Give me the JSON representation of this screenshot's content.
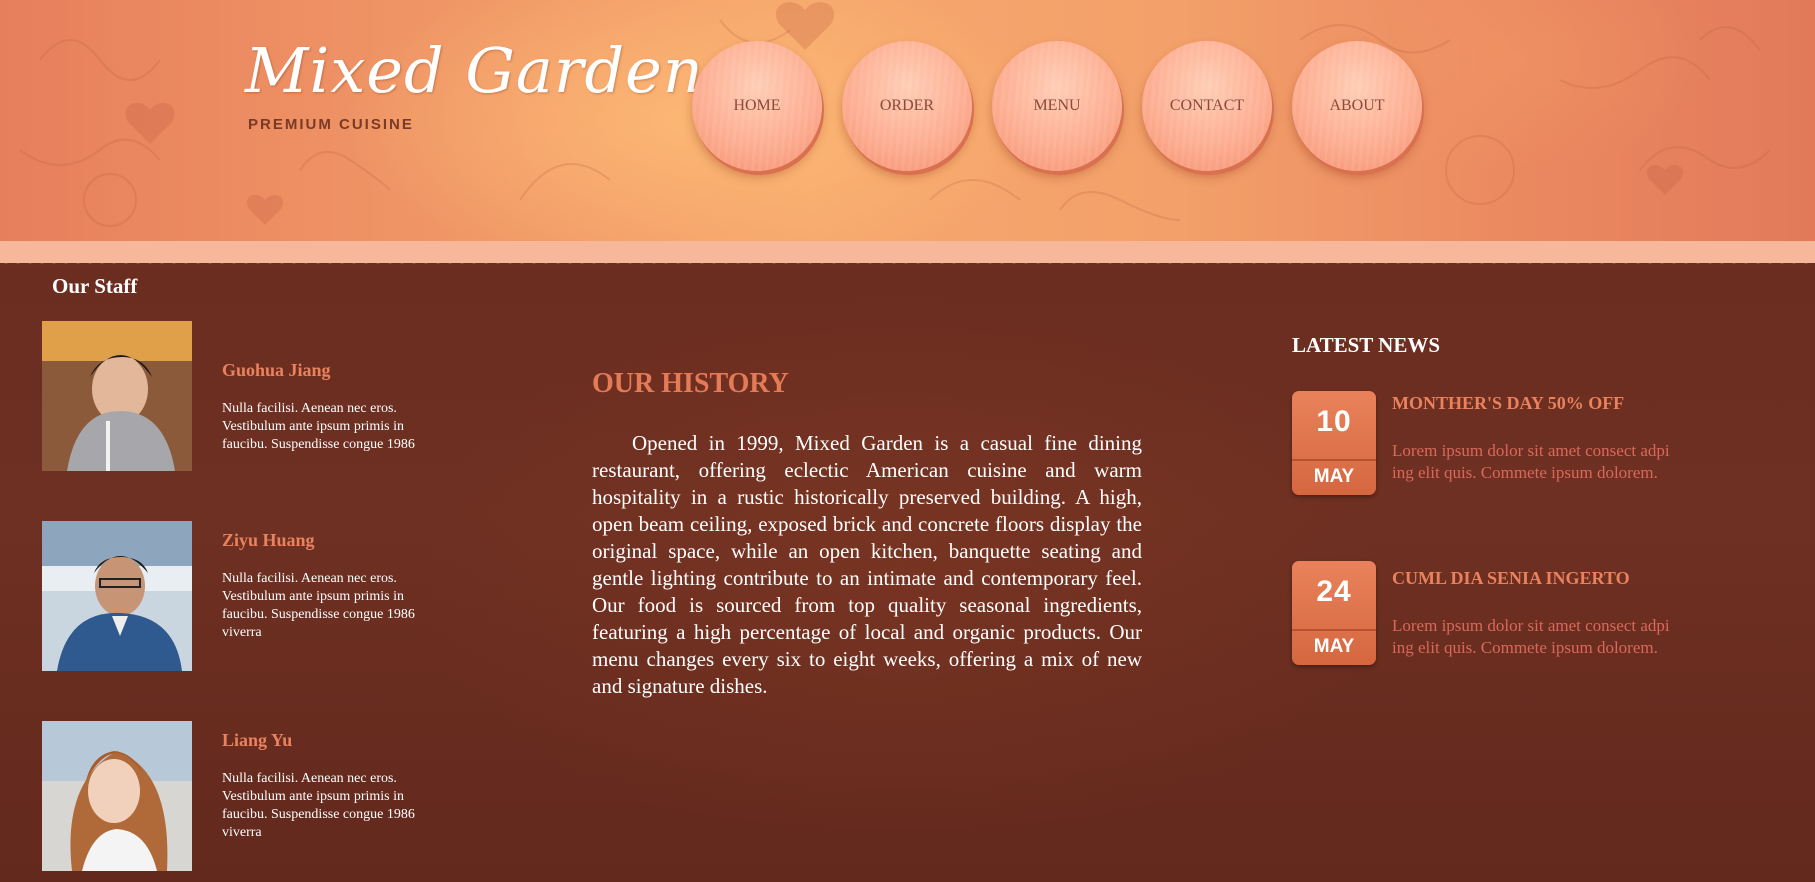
{
  "header": {
    "logo": "Mixed Garden",
    "tagline": "PREMIUM CUISINE",
    "nav": [
      {
        "label": "HOME"
      },
      {
        "label": "ORDER"
      },
      {
        "label": "MENU"
      },
      {
        "label": "CONTACT"
      },
      {
        "label": "ABOUT"
      }
    ]
  },
  "staff": {
    "title": "Our Staff",
    "members": [
      {
        "name": "Guohua Jiang",
        "desc": "Nulla facilisi. Aenean nec eros. Vestibulum ante ipsum primis in faucibu. Suspendisse congue 1986"
      },
      {
        "name": "Ziyu Huang",
        "desc": "Nulla facilisi. Aenean nec eros. Vestibulum ante ipsum primis in faucibu. Suspendisse congue 1986 viverra"
      },
      {
        "name": "Liang Yu",
        "desc": "Nulla facilisi. Aenean nec eros. Vestibulum ante ipsum primis in faucibu. Suspendisse congue 1986 viverra"
      }
    ]
  },
  "history": {
    "title": "OUR HISTORY",
    "text": "Opened in 1999, Mixed Garden is a casual fine dining restaurant, offering eclectic American cuisine and warm hospitality in a rustic historically preserved building. A high, open beam ceiling, exposed brick and concrete floors display the original space, while an open kitchen, banquette seating and gentle lighting contribute to an intimate and contemporary feel. Our food is sourced from top quality seasonal ingredients, featuring a high percentage of local and organic products. Our menu changes every six to eight weeks, offering a mix of new and signature dishes."
  },
  "news": {
    "title": "LATEST NEWS",
    "items": [
      {
        "day": "10",
        "month": "MAY",
        "headline": "MONTHER'S DAY 50% OFF",
        "body": "Lorem ipsum dolor sit amet consect adpi ing elit quis. Commete ipsum dolorem."
      },
      {
        "day": "24",
        "month": "MAY",
        "headline": "CUML DIA SENIA INGERTO",
        "body": "Lorem ipsum dolor sit amet consect adpi ing elit quis. Commete ipsum dolorem."
      }
    ]
  },
  "colors": {
    "header_orange": "#f09766",
    "main_brown": "#6b2d20",
    "accent_orange": "#e9825d",
    "news_body": "#d9685a"
  }
}
